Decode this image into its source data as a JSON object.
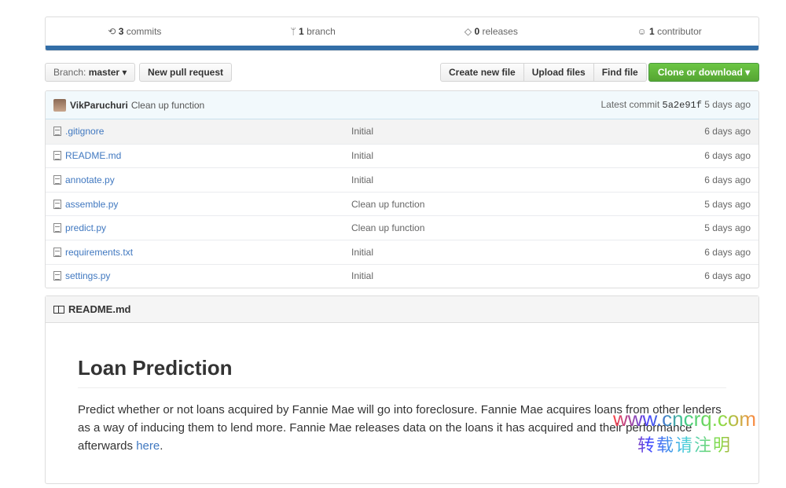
{
  "summary": {
    "commits_count": "3",
    "commits_label": "commits",
    "branch_count": "1",
    "branch_label": "branch",
    "releases_count": "0",
    "releases_label": "releases",
    "contributor_count": "1",
    "contributor_label": "contributor",
    "bar_color": "#336ea7"
  },
  "toolbar": {
    "branch_prefix": "Branch:",
    "branch_name": "master",
    "new_pr": "New pull request",
    "create_file": "Create new file",
    "upload_files": "Upload files",
    "find_file": "Find file",
    "clone": "Clone or download",
    "clone_color": "#6cc644"
  },
  "latest_commit": {
    "author": "VikParuchuri",
    "message": "Clean up function",
    "prefix": "Latest commit",
    "sha": "5a2e91f",
    "age": "5 days ago"
  },
  "files": [
    {
      "name": ".gitignore",
      "message": "Initial",
      "age": "6 days ago"
    },
    {
      "name": "README.md",
      "message": "Initial",
      "age": "6 days ago"
    },
    {
      "name": "annotate.py",
      "message": "Initial",
      "age": "6 days ago"
    },
    {
      "name": "assemble.py",
      "message": "Clean up function",
      "age": "5 days ago"
    },
    {
      "name": "predict.py",
      "message": "Clean up function",
      "age": "5 days ago"
    },
    {
      "name": "requirements.txt",
      "message": "Initial",
      "age": "6 days ago"
    },
    {
      "name": "settings.py",
      "message": "Initial",
      "age": "6 days ago"
    }
  ],
  "readme": {
    "header": "README.md",
    "title": "Loan Prediction",
    "paragraph": "Predict whether or not loans acquired by Fannie Mae will go into foreclosure. Fannie Mae acquires loans from other lenders as a way of inducing them to lend more. Fannie Mae releases data on the loans it has acquired and their performance afterwards ",
    "link": "here",
    "end": "."
  },
  "watermark": {
    "url": "www.cncrq.com",
    "text": "转载请注明"
  }
}
